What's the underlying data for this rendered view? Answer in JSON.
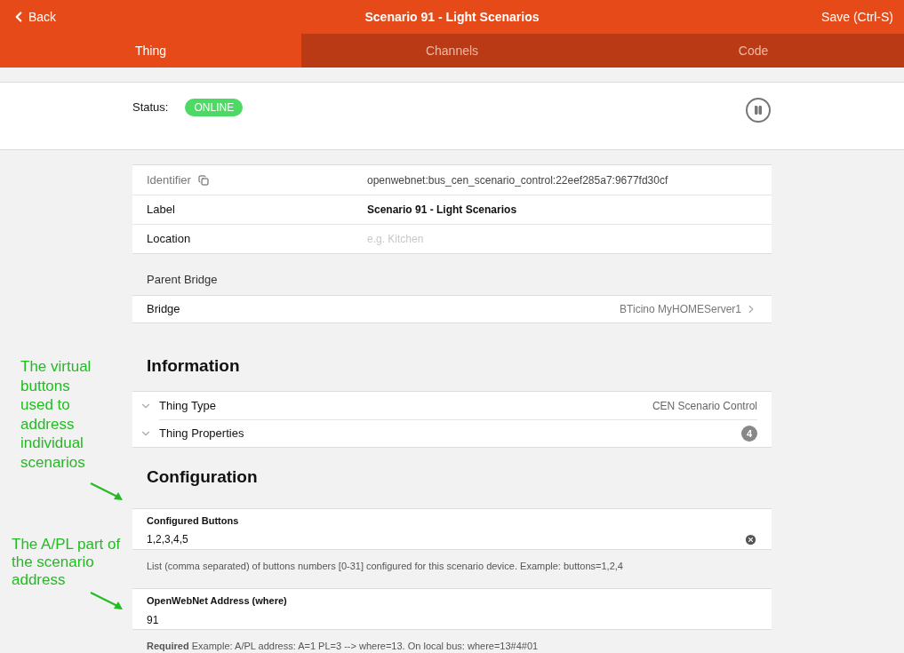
{
  "header": {
    "back": "Back",
    "title": "Scenario 91 - Light Scenarios",
    "save": "Save (Ctrl-S)"
  },
  "tabs": [
    {
      "label": "Thing",
      "selected": true
    },
    {
      "label": "Channels",
      "selected": false
    },
    {
      "label": "Code",
      "selected": false
    }
  ],
  "status": {
    "label": "Status:",
    "badge": "ONLINE",
    "online": true
  },
  "details": [
    {
      "label": "Identifier",
      "value": "openwebnet:bus_cen_scenario_control:22eef285a7:9677fd30cf",
      "kind": "identifier"
    },
    {
      "label": "Label",
      "value": "Scenario 91 - Light Scenarios",
      "kind": "text"
    },
    {
      "label": "Location",
      "placeholder": "e.g. Kitchen",
      "kind": "input"
    }
  ],
  "parent_bridge": {
    "heading": "Parent Bridge",
    "label": "Bridge",
    "value": "BTicino MyHOMEServer1"
  },
  "information": {
    "heading": "Information",
    "items": [
      {
        "label": "Thing Type",
        "value": "CEN Scenario Control",
        "expanded": false
      },
      {
        "label": "Thing Properties",
        "count": "4",
        "expanded": false
      }
    ]
  },
  "configuration": {
    "heading": "Configuration",
    "fields": [
      {
        "label": "Configured Buttons",
        "value": "1,2,3,4,5",
        "clearable": true,
        "description": "List (comma separated) of buttons numbers [0-31] configured for this scenario device. Example: buttons=1,2,4"
      },
      {
        "label": "OpenWebNet Address (where)",
        "value": "91",
        "clearable": false,
        "description": "**Required** Example: A/PL address: A=1 PL=3 --> where=13. On local bus: where=13#4#01"
      }
    ]
  },
  "annotations": [
    "The virtual buttons used to address individual scenarios",
    "The A/PL part of the scenario address"
  ]
}
